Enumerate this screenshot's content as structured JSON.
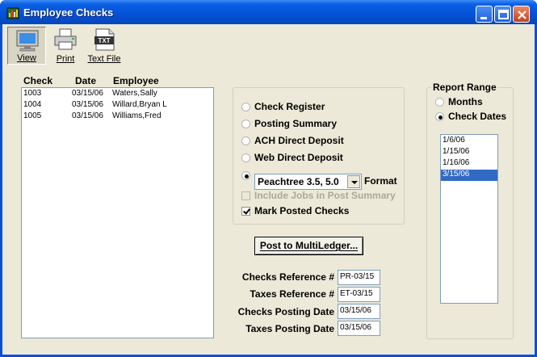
{
  "window": {
    "title": "Employee Checks"
  },
  "toolbar": {
    "view_label": "View",
    "print_label": "Print",
    "textfile_label": "Text File",
    "textfile_icon_text": "TXT"
  },
  "checks_list": {
    "headers": {
      "check": "Check",
      "date": "Date",
      "employee": "Employee"
    },
    "rows": [
      {
        "check": "1003",
        "date": "03/15/06",
        "employee": "Waters,Sally"
      },
      {
        "check": "1004",
        "date": "03/15/06",
        "employee": "Willard,Bryan L"
      },
      {
        "check": "1005",
        "date": "03/15/06",
        "employee": "Williams,Fred"
      }
    ]
  },
  "report_options": {
    "check_register": "Check Register",
    "posting_summary": "Posting Summary",
    "ach_direct_deposit": "ACH Direct Deposit",
    "web_direct_deposit": "Web Direct Deposit",
    "format_select_value": "Peachtree 3.5, 5.0",
    "format_label": "Format",
    "selected": "format",
    "include_jobs": {
      "label": "Include Jobs in Post Summary",
      "checked": false,
      "enabled": false
    },
    "mark_posted": {
      "label": "Mark Posted Checks",
      "checked": true
    }
  },
  "post_button": "Post to MultiLedger...",
  "fields": {
    "checks_reference": {
      "label": "Checks Reference #",
      "value": "PR-03/15"
    },
    "taxes_reference": {
      "label": "Taxes Reference #",
      "value": "ET-03/15"
    },
    "checks_posting_date": {
      "label": "Checks Posting Date",
      "value": "03/15/06"
    },
    "taxes_posting_date": {
      "label": "Taxes Posting Date",
      "value": "03/15/06"
    }
  },
  "report_range": {
    "title": "Report Range",
    "months_label": "Months",
    "check_dates_label": "Check Dates",
    "selected": "check_dates",
    "dates": [
      "1/6/06",
      "1/15/06",
      "1/16/06",
      "3/15/06"
    ],
    "selected_date": "3/15/06"
  },
  "colors": {
    "titlebar": "#0551d6",
    "face": "#ece9d8",
    "selection": "#316ac5"
  }
}
